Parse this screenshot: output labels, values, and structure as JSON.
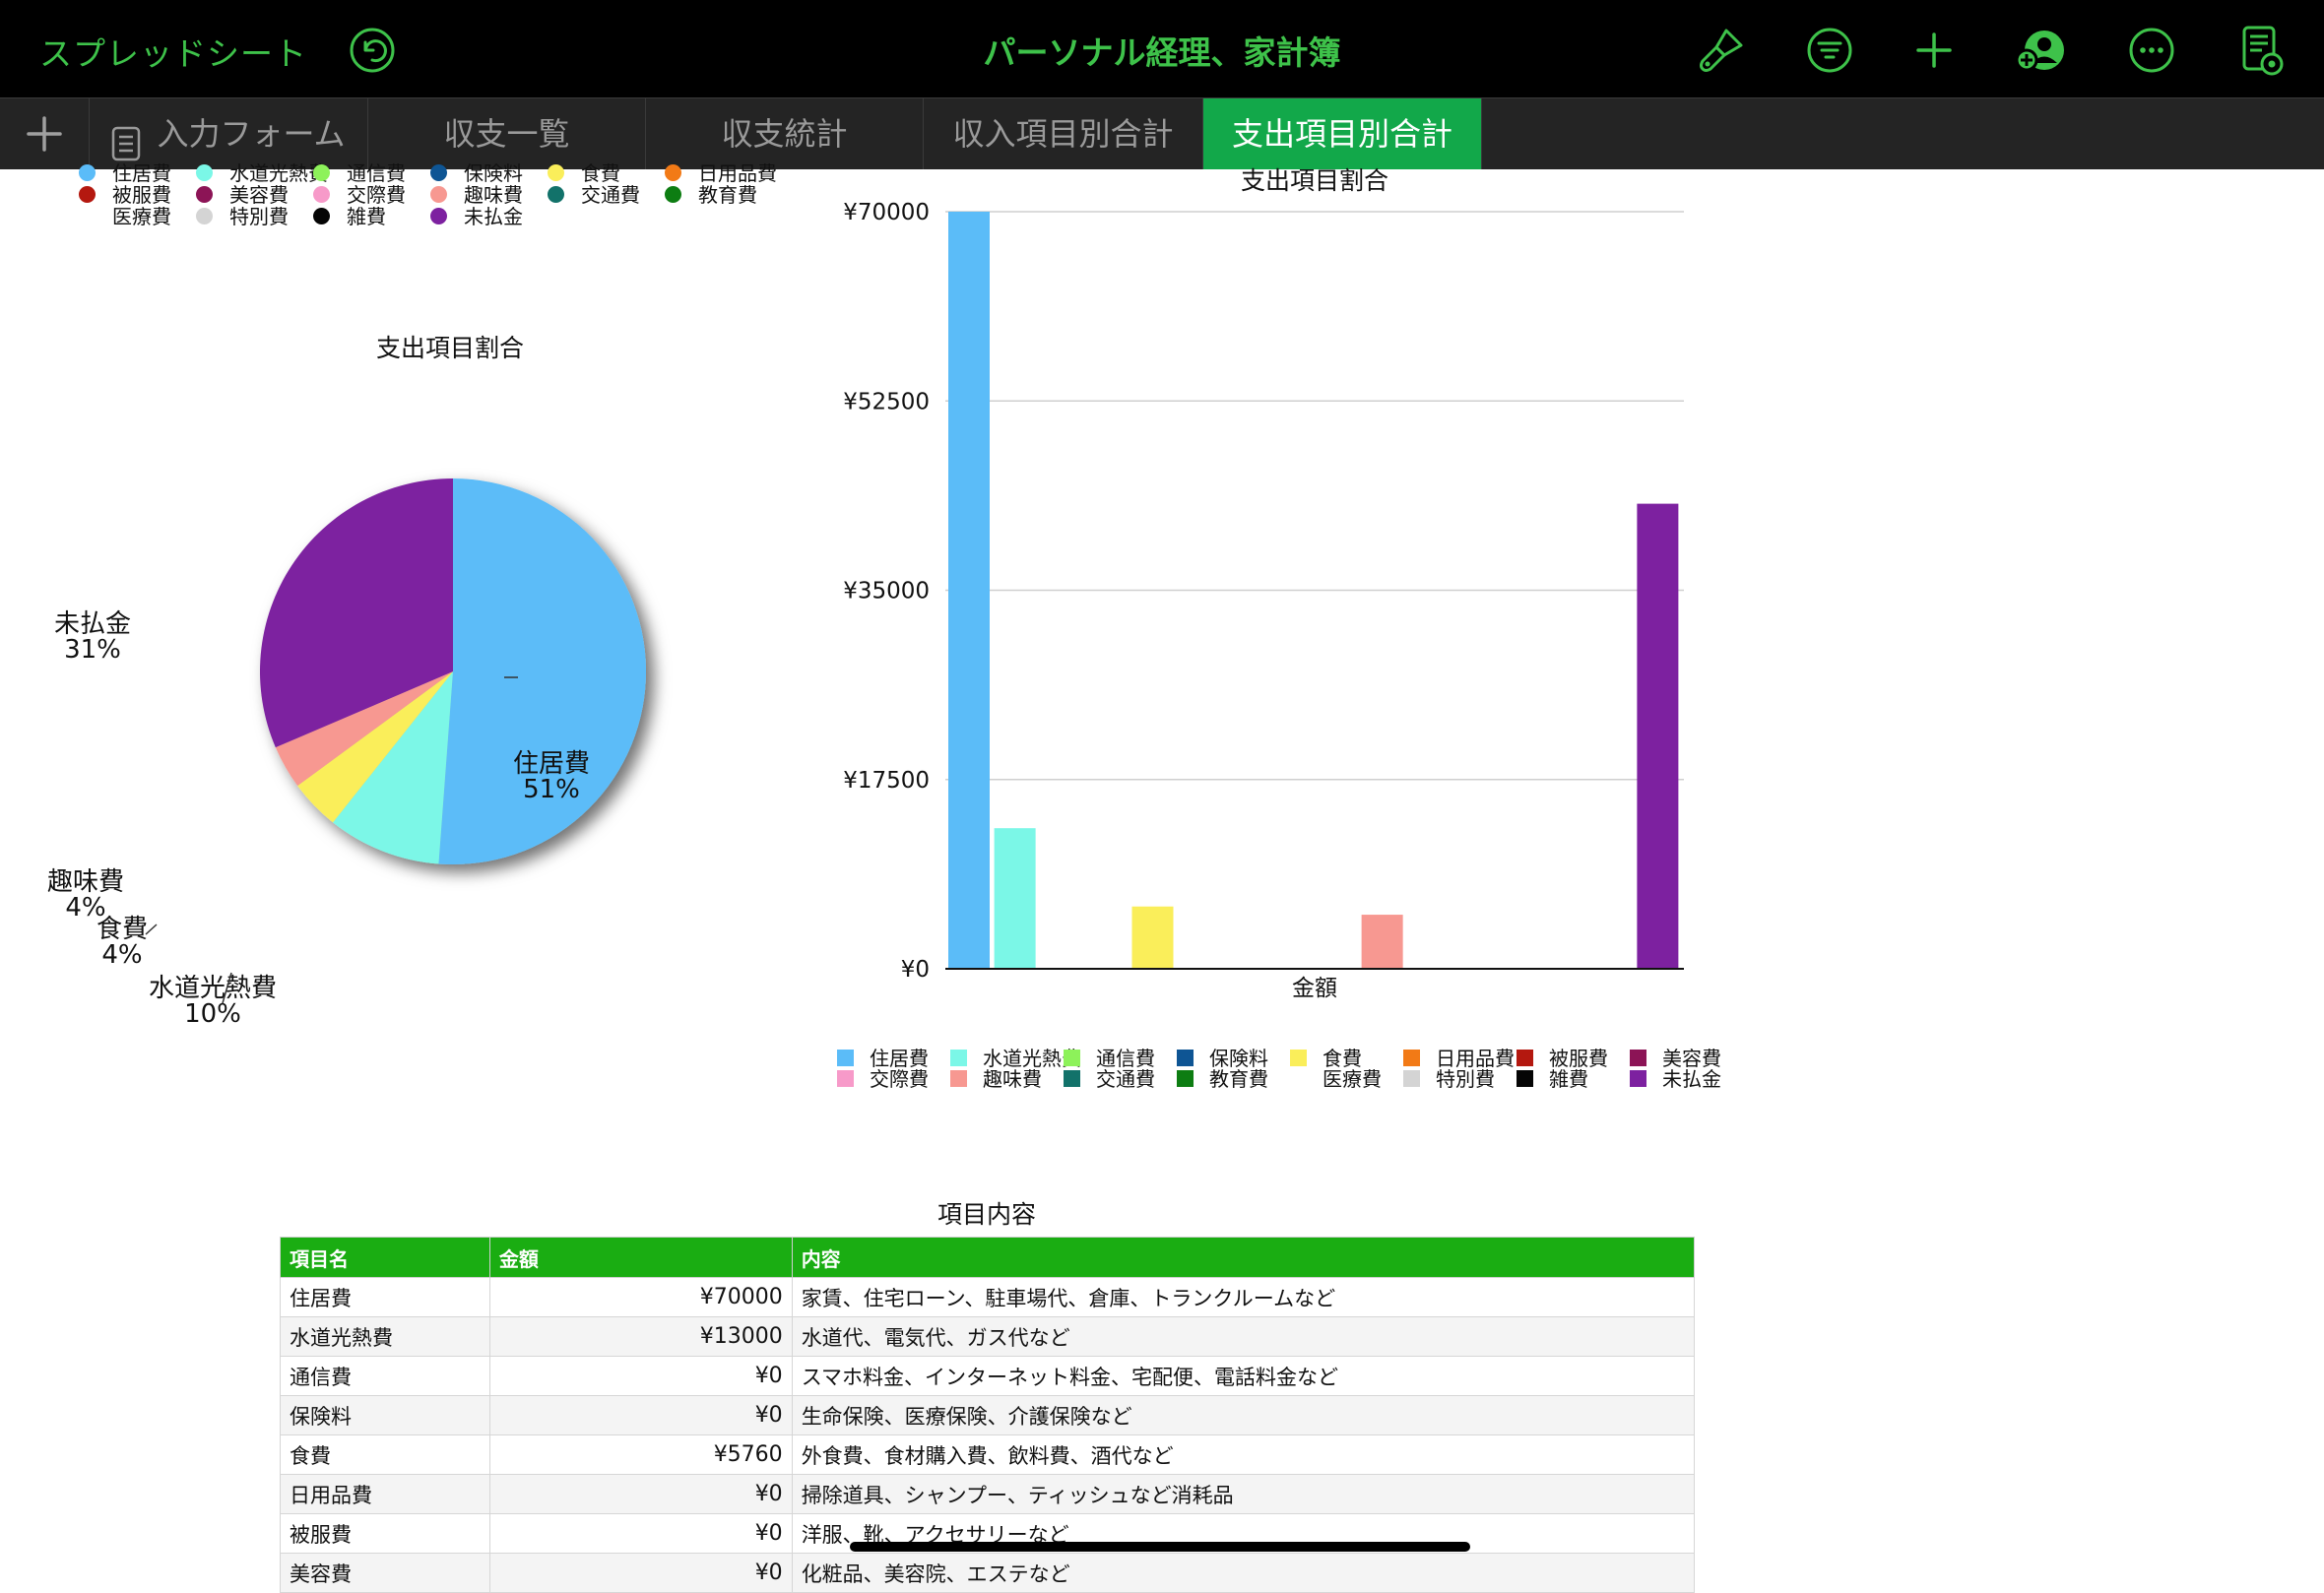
{
  "toolbar": {
    "back_label": "スプレッドシート",
    "title": "パーソナル経理、家計簿",
    "icons": [
      "undo-icon",
      "paintbrush-icon",
      "filter-icon",
      "add-icon",
      "collaborate-icon",
      "more-icon",
      "reading-view-icon"
    ]
  },
  "tabs": [
    {
      "label": "入力フォーム",
      "active": false
    },
    {
      "label": "収支一覧",
      "active": false
    },
    {
      "label": "収支統計",
      "active": false
    },
    {
      "label": "収入項目別合計",
      "active": false
    },
    {
      "label": "支出項目別合計",
      "active": true
    }
  ],
  "categories": [
    {
      "name": "住居費",
      "color": "#5bbcf8"
    },
    {
      "name": "水道光熱費",
      "color": "#7bf7e7"
    },
    {
      "name": "通信費",
      "color": "#8df25a"
    },
    {
      "name": "保険料",
      "color": "#0e5594"
    },
    {
      "name": "食費",
      "color": "#faee5a"
    },
    {
      "name": "日用品費",
      "color": "#f27a16"
    },
    {
      "name": "被服費",
      "color": "#b4180f"
    },
    {
      "name": "美容費",
      "color": "#8c1456"
    },
    {
      "name": "交際費",
      "color": "#f79ac9"
    },
    {
      "name": "趣味費",
      "color": "#f79891"
    },
    {
      "name": "交通費",
      "color": "#12726a"
    },
    {
      "name": "教育費",
      "color": "#0d7d12"
    },
    {
      "name": "医療費",
      "color": "#ffffff"
    },
    {
      "name": "特別費",
      "color": "#d4d4d4"
    },
    {
      "name": "雑費",
      "color": "#050505"
    },
    {
      "name": "未払金",
      "color": "#7d21a0"
    }
  ],
  "chart_data": [
    {
      "type": "pie",
      "title": "支出項目割合",
      "slices": [
        {
          "label": "住居費",
          "value": 70000,
          "percent_label": "51%",
          "color": "#5bbcf8"
        },
        {
          "label": "水道光熱費",
          "value": 13000,
          "percent_label": "10%",
          "color": "#7bf7e7"
        },
        {
          "label": "食費",
          "value": 5760,
          "percent_label": "4%",
          "color": "#faee5a"
        },
        {
          "label": "趣味費",
          "value": 5000,
          "percent_label": "4%",
          "color": "#f79891"
        },
        {
          "label": "未払金",
          "value": 43000,
          "percent_label": "31%",
          "color": "#7d21a0"
        }
      ]
    },
    {
      "type": "bar",
      "title": "支出項目割合",
      "xlabel": "金額",
      "ylim": [
        0,
        70000
      ],
      "ticks": [
        "¥0",
        "¥17500",
        "¥35000",
        "¥52500",
        "¥70000"
      ],
      "tick_values": [
        0,
        17500,
        35000,
        52500,
        70000
      ],
      "series": [
        {
          "name": "住居費",
          "value": 70000,
          "color": "#5bbcf8"
        },
        {
          "name": "水道光熱費",
          "value": 13000,
          "color": "#7bf7e7"
        },
        {
          "name": "通信費",
          "value": 0,
          "color": "#8df25a"
        },
        {
          "name": "保険料",
          "value": 0,
          "color": "#0e5594"
        },
        {
          "name": "食費",
          "value": 5760,
          "color": "#faee5a"
        },
        {
          "name": "日用品費",
          "value": 0,
          "color": "#f27a16"
        },
        {
          "name": "被服費",
          "value": 0,
          "color": "#b4180f"
        },
        {
          "name": "美容費",
          "value": 0,
          "color": "#8c1456"
        },
        {
          "name": "交際費",
          "value": 0,
          "color": "#f79ac9"
        },
        {
          "name": "趣味費",
          "value": 5000,
          "color": "#f79891"
        },
        {
          "name": "交通費",
          "value": 0,
          "color": "#12726a"
        },
        {
          "name": "教育費",
          "value": 0,
          "color": "#0d7d12"
        },
        {
          "name": "医療費",
          "value": 0,
          "color": "#ffffff"
        },
        {
          "name": "特別費",
          "value": 0,
          "color": "#d4d4d4"
        },
        {
          "name": "雑費",
          "value": 0,
          "color": "#050505"
        },
        {
          "name": "未払金",
          "value": 43000,
          "color": "#7d21a0"
        }
      ]
    }
  ],
  "table": {
    "title": "項目内容",
    "headers": [
      "項目名",
      "金額",
      "内容"
    ],
    "rows": [
      [
        "住居費",
        "¥70000",
        "家賃、住宅ローン、駐車場代、倉庫、トランクルームなど"
      ],
      [
        "水道光熱費",
        "¥13000",
        "水道代、電気代、ガス代など"
      ],
      [
        "通信費",
        "¥0",
        "スマホ料金、インターネット料金、宅配便、電話料金など"
      ],
      [
        "保険料",
        "¥0",
        "生命保険、医療保険、介護保険など"
      ],
      [
        "食費",
        "¥5760",
        "外食費、食材購入費、飲料費、酒代など"
      ],
      [
        "日用品費",
        "¥0",
        "掃除道具、シャンプー、ティッシュなど消耗品"
      ],
      [
        "被服費",
        "¥0",
        "洋服、靴、アクセサリーなど"
      ],
      [
        "美容費",
        "¥0",
        "化粧品、美容院、エステなど"
      ]
    ]
  }
}
